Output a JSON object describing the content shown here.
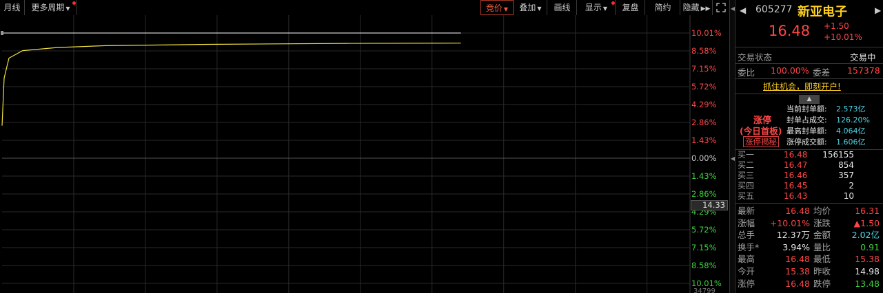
{
  "toolbar": {
    "month_label": "月线",
    "more_periods_label": "更多周期",
    "auction_label": "竞价",
    "overlay_label": "叠加",
    "draw_label": "画线",
    "display_label": "显示",
    "review_label": "复盘",
    "simple_label": "简约",
    "hide_label": "隐藏",
    "expand_icon": "expand-icon"
  },
  "chart": {
    "type": "line",
    "price_readout": "14.33",
    "volume_tick": "34799",
    "y_ticks": [
      {
        "label": "10.01%",
        "pct": 10.01
      },
      {
        "label": "8.58%",
        "pct": 8.58
      },
      {
        "label": "7.15%",
        "pct": 7.15
      },
      {
        "label": "5.72%",
        "pct": 5.72
      },
      {
        "label": "4.29%",
        "pct": 4.29
      },
      {
        "label": "2.86%",
        "pct": 2.86
      },
      {
        "label": "1.43%",
        "pct": 1.43
      },
      {
        "label": "0.00%",
        "pct": 0.0
      },
      {
        "label": "1.43%",
        "pct": -1.43
      },
      {
        "label": "2.86%",
        "pct": -2.86
      },
      {
        "label": "4.29%",
        "pct": -4.29
      },
      {
        "label": "5.72%",
        "pct": -5.72
      },
      {
        "label": "7.15%",
        "pct": -7.15
      },
      {
        "label": "8.58%",
        "pct": -8.58
      },
      {
        "label": "10.01%",
        "pct": -10.01
      }
    ],
    "ylim": [
      -10.01,
      10.01
    ],
    "time_fraction_elapsed": 0.667,
    "price_series": [
      [
        0,
        2.6
      ],
      [
        0.003,
        6.4
      ],
      [
        0.01,
        8.0
      ],
      [
        0.03,
        8.6
      ],
      [
        0.08,
        8.85
      ],
      [
        0.15,
        9.0
      ],
      [
        0.3,
        9.1
      ],
      [
        0.5,
        9.18
      ],
      [
        0.667,
        9.2
      ]
    ],
    "avg_series": [
      [
        0,
        2.6
      ],
      [
        0.004,
        4.8
      ],
      [
        0.008,
        7.0
      ],
      [
        0.015,
        8.2
      ],
      [
        0.03,
        8.85
      ],
      [
        0.06,
        9.1
      ],
      [
        0.1,
        9.3
      ],
      [
        0.2,
        9.5
      ],
      [
        0.35,
        9.62
      ],
      [
        0.5,
        9.72
      ],
      [
        0.667,
        9.8
      ]
    ],
    "limit_line_pct": 10.01,
    "colors": {
      "price": "#ffffff",
      "avg": "#f0e040",
      "grid": "#2a2a2a",
      "up": "#ff4646",
      "down": "#3fd23f"
    }
  },
  "stock": {
    "code": "605277",
    "name": "新亚电子",
    "price": "16.48",
    "change": "+1.50",
    "change_pct": "+10.01%"
  },
  "status": {
    "label": "交易状态",
    "value": "交易中",
    "ratio_label": "委比",
    "ratio_value": "100.00%",
    "diff_label": "委差",
    "diff_value": "157378"
  },
  "promo": "抓住机会，即刻开户!",
  "limit_up": {
    "title": "涨停",
    "subtitle": "(今日首板)",
    "reveal_button": "涨停揭秘",
    "rows": [
      {
        "label": "当前封单额:",
        "value": "2.573亿"
      },
      {
        "label": "封单占成交:",
        "value": "126.20%"
      },
      {
        "label": "最高封单额:",
        "value": "4.064亿"
      },
      {
        "label": "涨停成交额:",
        "value": "1.606亿"
      }
    ]
  },
  "order_book": [
    {
      "label": "买一",
      "price": "16.48",
      "vol": "156155"
    },
    {
      "label": "买二",
      "price": "16.47",
      "vol": "854"
    },
    {
      "label": "买三",
      "price": "16.46",
      "vol": "357"
    },
    {
      "label": "买四",
      "price": "16.45",
      "vol": "2"
    },
    {
      "label": "买五",
      "price": "16.43",
      "vol": "10"
    }
  ],
  "quote": [
    {
      "l1": "最新",
      "v1": "16.48",
      "c1": "red",
      "l2": "均价",
      "v2": "16.31",
      "c2": "red"
    },
    {
      "l1": "涨幅",
      "v1": "+10.01%",
      "c1": "red",
      "l2": "涨跌",
      "v2": "▲1.50",
      "c2": "red"
    },
    {
      "l1": "总手",
      "v1": "12.37万",
      "c1": "white",
      "l2": "金额",
      "v2": "2.02亿",
      "c2": "cyan"
    },
    {
      "l1": "换手*",
      "v1": "3.94%",
      "c1": "white",
      "l2": "量比",
      "v2": "0.91",
      "c2": "green"
    },
    {
      "l1": "最高",
      "v1": "16.48",
      "c1": "red",
      "l2": "最低",
      "v2": "15.38",
      "c2": "red"
    },
    {
      "l1": "今开",
      "v1": "15.38",
      "c1": "red",
      "l2": "昨收",
      "v2": "14.98",
      "c2": "white"
    },
    {
      "l1": "涨停",
      "v1": "16.48",
      "c1": "red",
      "l2": "跌停",
      "v2": "13.48",
      "c2": "green"
    }
  ]
}
